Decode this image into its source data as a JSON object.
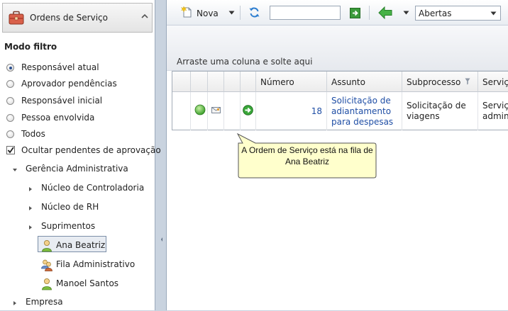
{
  "left_panel": {
    "title": "Ordens de Serviço",
    "filter_mode_title": "Modo filtro",
    "filter_options": [
      {
        "label": "Responsável atual",
        "selected": true
      },
      {
        "label": "Aprovador pendências",
        "selected": false
      },
      {
        "label": "Responsável inicial",
        "selected": false
      },
      {
        "label": "Pessoa envolvida",
        "selected": false
      },
      {
        "label": "Todos",
        "selected": false
      }
    ],
    "hide_pending_checkbox": {
      "label": "Ocultar pendentes de aprovação",
      "checked": true
    },
    "tree": {
      "root": {
        "label": "Gerência Administrativa",
        "expanded": true
      },
      "groups": [
        {
          "label": "Núcleo de Controladoria",
          "expanded": false
        },
        {
          "label": "Núcleo de RH",
          "expanded": false
        },
        {
          "label": "Suprimentos",
          "expanded": false
        }
      ],
      "people": [
        {
          "label": "Ana Beatriz",
          "icon": "user-icon",
          "selected": true
        },
        {
          "label": "Fila Administrativo",
          "icon": "user-group-icon",
          "selected": false
        },
        {
          "label": "Manoel Santos",
          "icon": "user-icon",
          "selected": false
        }
      ],
      "other_root": {
        "label": "Empresa",
        "expanded": false
      }
    }
  },
  "toolbar": {
    "new_label": "Nova",
    "search_value": "",
    "status_filter_value": "Abertas"
  },
  "grid": {
    "group_hint": "Arraste uma coluna e solte aqui",
    "columns": [
      "Número",
      "Assunto",
      "Subprocesso",
      "Serviç"
    ],
    "rows": [
      {
        "status_icon": "green-status-icon",
        "mail_icon": "envelope-icon",
        "action_icon": "green-arrow-icon",
        "numero": "18",
        "assunto": "Solicitação de\nadiantamento\npara despesas",
        "subprocesso": "Solicitação de\nviagens",
        "servico": "Serviç\nadmin"
      }
    ]
  },
  "tooltip": {
    "text": "A Ordem de Serviço está na fila de Ana Beatriz"
  },
  "colors": {
    "link": "#1f4ea5",
    "selection_border": "#7c8fa8",
    "tooltip_fill": "#ffffcc",
    "status_green": "#3cb33c"
  }
}
